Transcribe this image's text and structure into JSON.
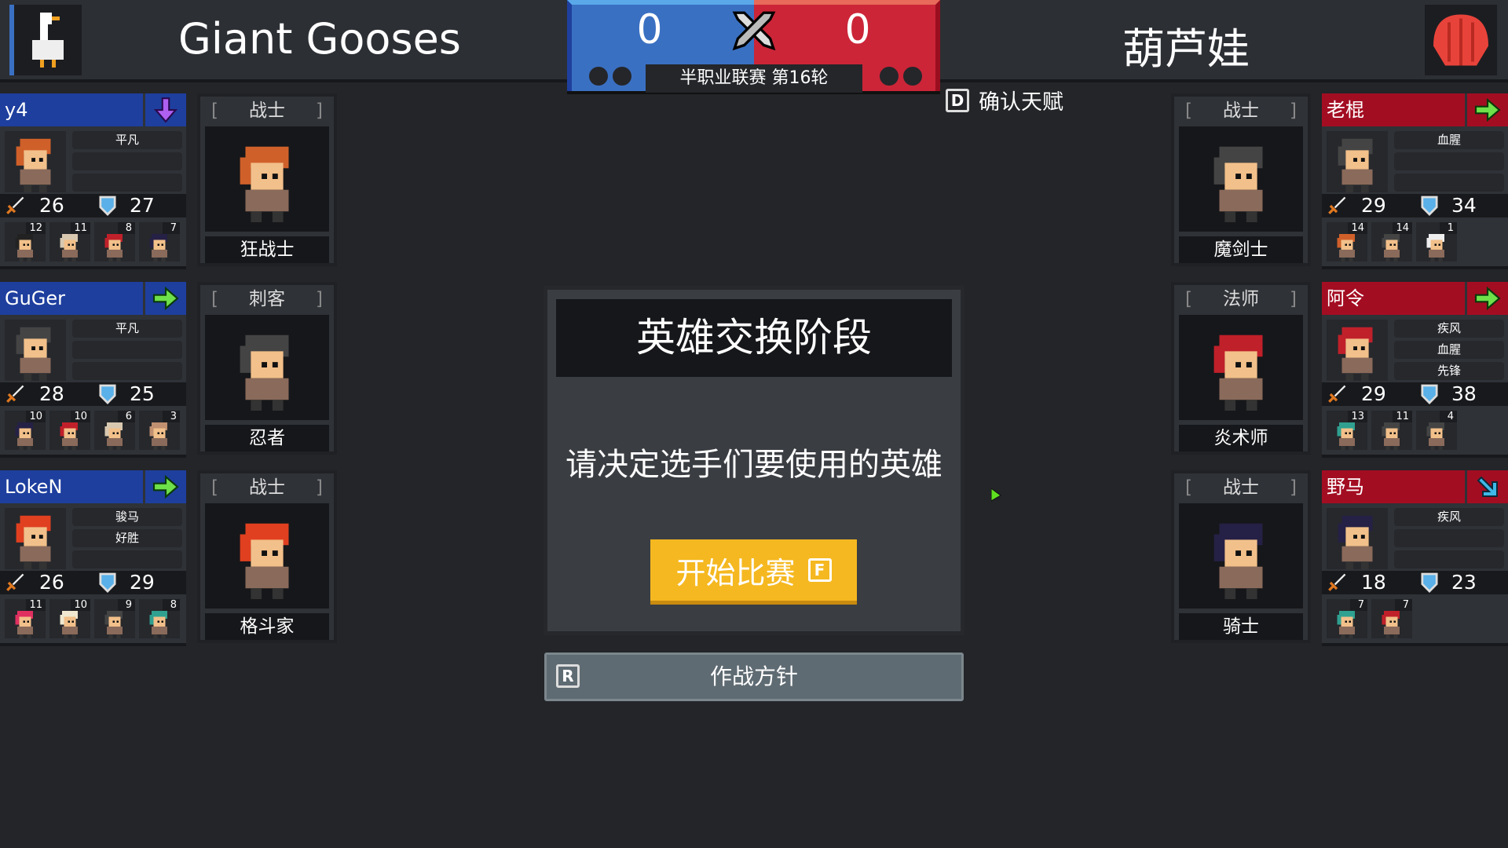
{
  "colors": {
    "left_team": "#1e3f9e",
    "right_team": "#a30d22",
    "start_button": "#f5b820",
    "blue_score": "#3a70c2",
    "red_score": "#cc2538"
  },
  "left_team": {
    "name": "Giant Gooses",
    "score": "0",
    "logo": "goose-icon"
  },
  "right_team": {
    "name": "葫芦娃",
    "score": "0",
    "logo": "shell-icon"
  },
  "match": {
    "label": "半职业联赛 第16轮",
    "center_icon": "crossed-swords-icon"
  },
  "confirm_talent": {
    "key": "D",
    "label": "确认天赋"
  },
  "left_players": [
    {
      "name": "y4",
      "action": "arrow-down-icon",
      "traits": [
        "平凡",
        "",
        ""
      ],
      "atk": "26",
      "def": "27",
      "hair": "#d0602a",
      "class_label": "战士",
      "hero_name": "狂战士",
      "history": [
        {
          "count": "12",
          "hair": "#222"
        },
        {
          "count": "11",
          "hair": "#d8c8b0"
        },
        {
          "count": "8",
          "hair": "#c0202a"
        },
        {
          "count": "7",
          "hair": "#252045"
        }
      ]
    },
    {
      "name": "GuGer",
      "action": "arrow-right-icon",
      "traits": [
        "平凡",
        "",
        ""
      ],
      "atk": "28",
      "def": "25",
      "hair": "#444",
      "class_label": "刺客",
      "hero_name": "忍者",
      "history": [
        {
          "count": "10",
          "hair": "#252045"
        },
        {
          "count": "10",
          "hair": "#c0202a"
        },
        {
          "count": "6",
          "hair": "#d8c8b0"
        },
        {
          "count": "3",
          "hair": "#c09070"
        }
      ]
    },
    {
      "name": "LokeN",
      "action": "arrow-right-icon",
      "traits": [
        "骏马",
        "好胜",
        ""
      ],
      "atk": "26",
      "def": "29",
      "hair": "#e04020",
      "class_label": "战士",
      "hero_name": "格斗家",
      "history": [
        {
          "count": "11",
          "hair": "#e03060"
        },
        {
          "count": "10",
          "hair": "#f0e8d0"
        },
        {
          "count": "9",
          "hair": "#444"
        },
        {
          "count": "8",
          "hair": "#30a090"
        }
      ]
    }
  ],
  "right_players": [
    {
      "name": "老棍",
      "action": "arrow-right-icon",
      "traits": [
        "血腥",
        "",
        ""
      ],
      "atk": "29",
      "def": "34",
      "hair": "#444",
      "class_label": "战士",
      "hero_name": "魔剑士",
      "history": [
        {
          "count": "14",
          "hair": "#d0602a"
        },
        {
          "count": "14",
          "hair": "#444"
        },
        {
          "count": "1",
          "hair": "#eee"
        }
      ]
    },
    {
      "name": "阿令",
      "action": "arrow-right-icon",
      "traits": [
        "疾风",
        "血腥",
        "先锋"
      ],
      "atk": "29",
      "def": "38",
      "hair": "#c0202a",
      "class_label": "法师",
      "hero_name": "炎术师",
      "history": [
        {
          "count": "13",
          "hair": "#30a090"
        },
        {
          "count": "11",
          "hair": "#444"
        },
        {
          "count": "4",
          "hair": "#444"
        }
      ]
    },
    {
      "name": "野马",
      "action": "arrow-down-right-icon",
      "traits": [
        "疾风",
        "",
        ""
      ],
      "atk": "18",
      "def": "23",
      "hair": "#252045",
      "class_label": "战士",
      "hero_name": "骑士",
      "history": [
        {
          "count": "7",
          "hair": "#30a090"
        },
        {
          "count": "7",
          "hair": "#c0202a"
        }
      ]
    }
  ],
  "modal": {
    "title": "英雄交换阶段",
    "subtitle": "请决定选手们要使用的英雄",
    "start_label": "开始比赛",
    "start_key": "F"
  },
  "tactics": {
    "key": "R",
    "label": "作战方针"
  }
}
